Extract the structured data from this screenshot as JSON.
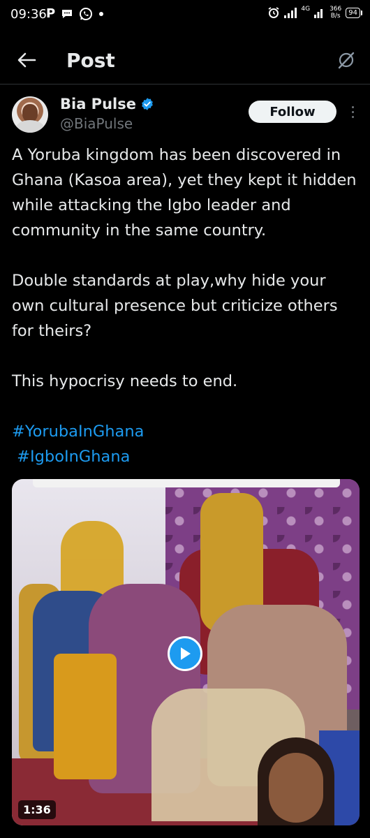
{
  "status_bar": {
    "time": "09:36",
    "left_icons": [
      "p-icon",
      "chat-bubble-icon",
      "whatsapp-icon",
      "dot-icon"
    ],
    "network": "4G",
    "net_speed_value": "366",
    "net_speed_unit": "B/s",
    "battery": "94"
  },
  "header": {
    "title": "Post"
  },
  "author": {
    "name": "Bia Pulse",
    "handle": "@BiaPulse",
    "verified": true,
    "follow_label": "Follow"
  },
  "tweet": {
    "paragraph_1": "A Yoruba kingdom has been discovered in Ghana (Kasoa area), yet they kept it hidden while attacking the Igbo leader and community in the same country.",
    "paragraph_2": "Double standards at play,why hide your own cultural presence but criticize others for theirs?",
    "paragraph_3": "This hypocrisy needs to end.",
    "hashtag_1": "#YorubaInGhana",
    "hashtag_2": " #IgboInGhana"
  },
  "media": {
    "duration": "1:36",
    "accent": "#1d9bf0"
  }
}
